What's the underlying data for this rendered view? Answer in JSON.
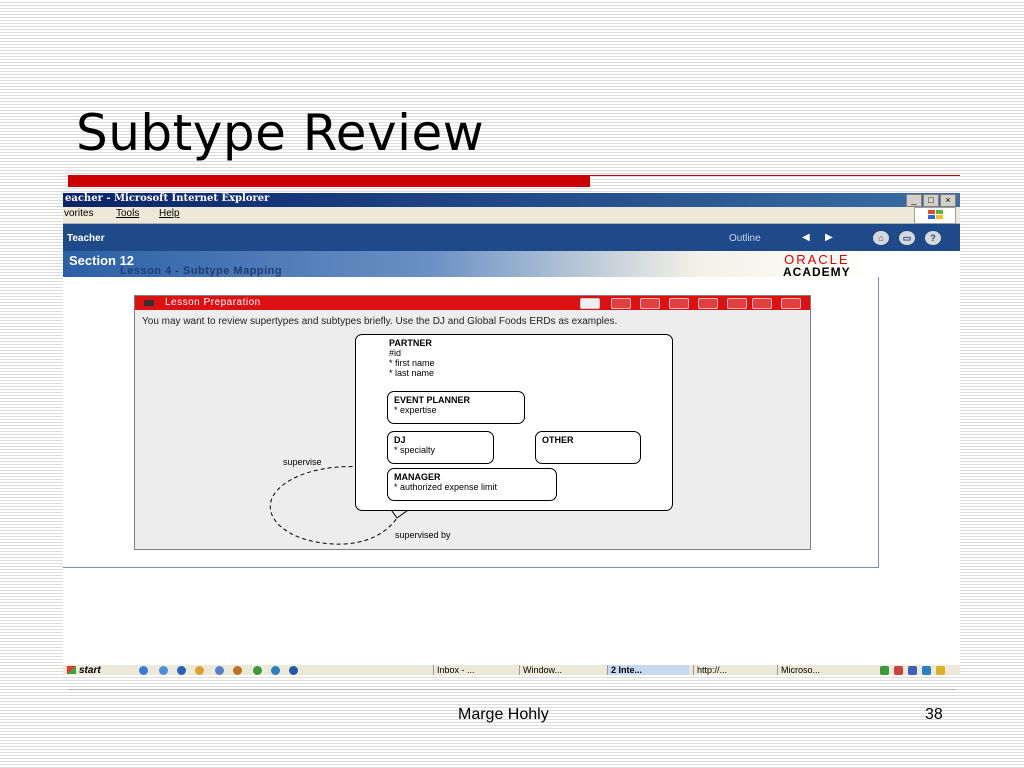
{
  "slide": {
    "title": "Subtype Review",
    "author": "Marge Hohly",
    "page_number": "38",
    "accent_color": "#cc0000"
  },
  "browser": {
    "window_title": "eacher - Microsoft Internet Explorer",
    "window_buttons": [
      "_",
      "□",
      "×"
    ],
    "menu": [
      "vorites",
      "Tools",
      "Help"
    ]
  },
  "app": {
    "name": "Teacher",
    "outline_label": "Outline",
    "prev_icon": "triangle-left-icon",
    "next_icon": "triangle-right-icon",
    "header_buttons": [
      "home-icon",
      "glossary-icon",
      "help-icon"
    ],
    "help_glyph": "?",
    "section": "Section 12",
    "lesson": "Lesson 4 - Subtype Mapping",
    "logo": {
      "line1": "ORACLE",
      "line2": "ACADEMY"
    }
  },
  "lesson_panel": {
    "title": "Lesson Preparation",
    "instruction": "You may want to review supertypes and subtypes briefly. Use the DJ and Global Foods ERDs as examples.",
    "header_color": "#dd1111"
  },
  "erd": {
    "supertype": {
      "name": "PARTNER",
      "attributes": [
        "#id",
        "* first name",
        "* last name"
      ]
    },
    "subtypes": [
      {
        "name": "EVENT PLANNER",
        "attributes": [
          "* expertise"
        ]
      },
      {
        "name": "DJ",
        "attributes": [
          "* specialty"
        ]
      },
      {
        "name": "OTHER",
        "attributes": []
      },
      {
        "name": "MANAGER",
        "attributes": [
          "* authorized expense limit"
        ]
      }
    ],
    "relationship": {
      "label_top": "supervise",
      "label_bottom": "supervised by"
    }
  },
  "taskbar": {
    "start": "start",
    "buttons": [
      {
        "label": "Inbox - ...",
        "active": false
      },
      {
        "label": "Window...",
        "active": false
      },
      {
        "label": "2 Inte...",
        "active": true
      },
      {
        "label": "http://...",
        "active": false
      },
      {
        "label": "Microso...",
        "active": false
      }
    ]
  }
}
